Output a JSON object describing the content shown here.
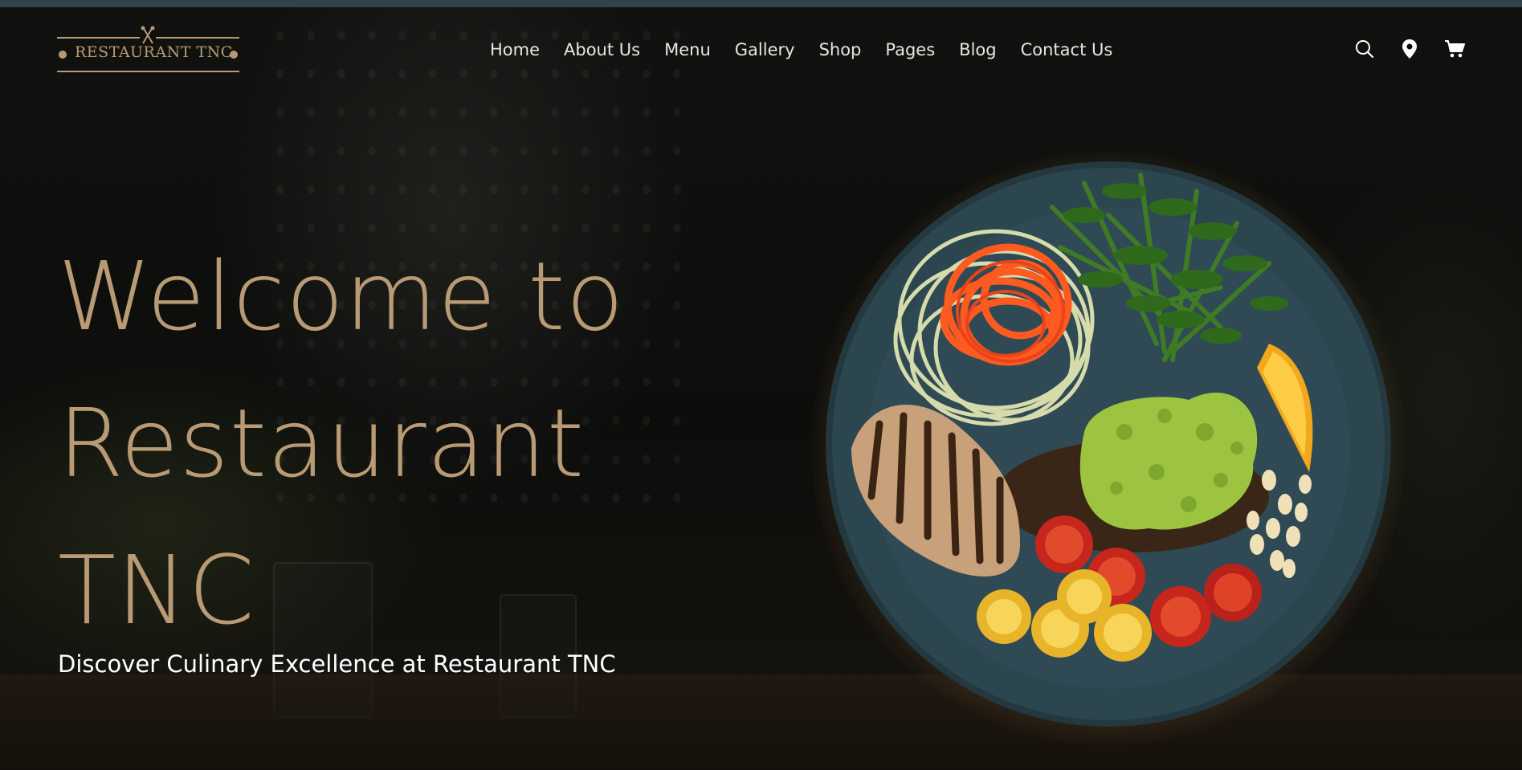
{
  "brand": {
    "logo_text": "RESTAURANT TNC",
    "accent_color": "#b89a74"
  },
  "nav": {
    "items": [
      {
        "label": "Home"
      },
      {
        "label": "About Us"
      },
      {
        "label": "Menu"
      },
      {
        "label": "Gallery"
      },
      {
        "label": "Shop"
      },
      {
        "label": "Pages"
      },
      {
        "label": "Blog"
      },
      {
        "label": "Contact Us"
      }
    ]
  },
  "header_icons": [
    {
      "icon": "search-icon"
    },
    {
      "icon": "location-pin-icon"
    },
    {
      "icon": "shopping-cart-icon"
    }
  ],
  "hero": {
    "title_lines": [
      "Welcome to",
      "Restaurant",
      "TNC"
    ],
    "subtitle": "Discover Culinary Excellence at Restaurant TNC",
    "image": "food-plate-illustration"
  },
  "colors": {
    "background": "#0c0c0b",
    "top_strip": "#2f434b",
    "title": "#b89a74",
    "nav_text": "#e8e6e1",
    "subtitle": "#ffffff"
  }
}
